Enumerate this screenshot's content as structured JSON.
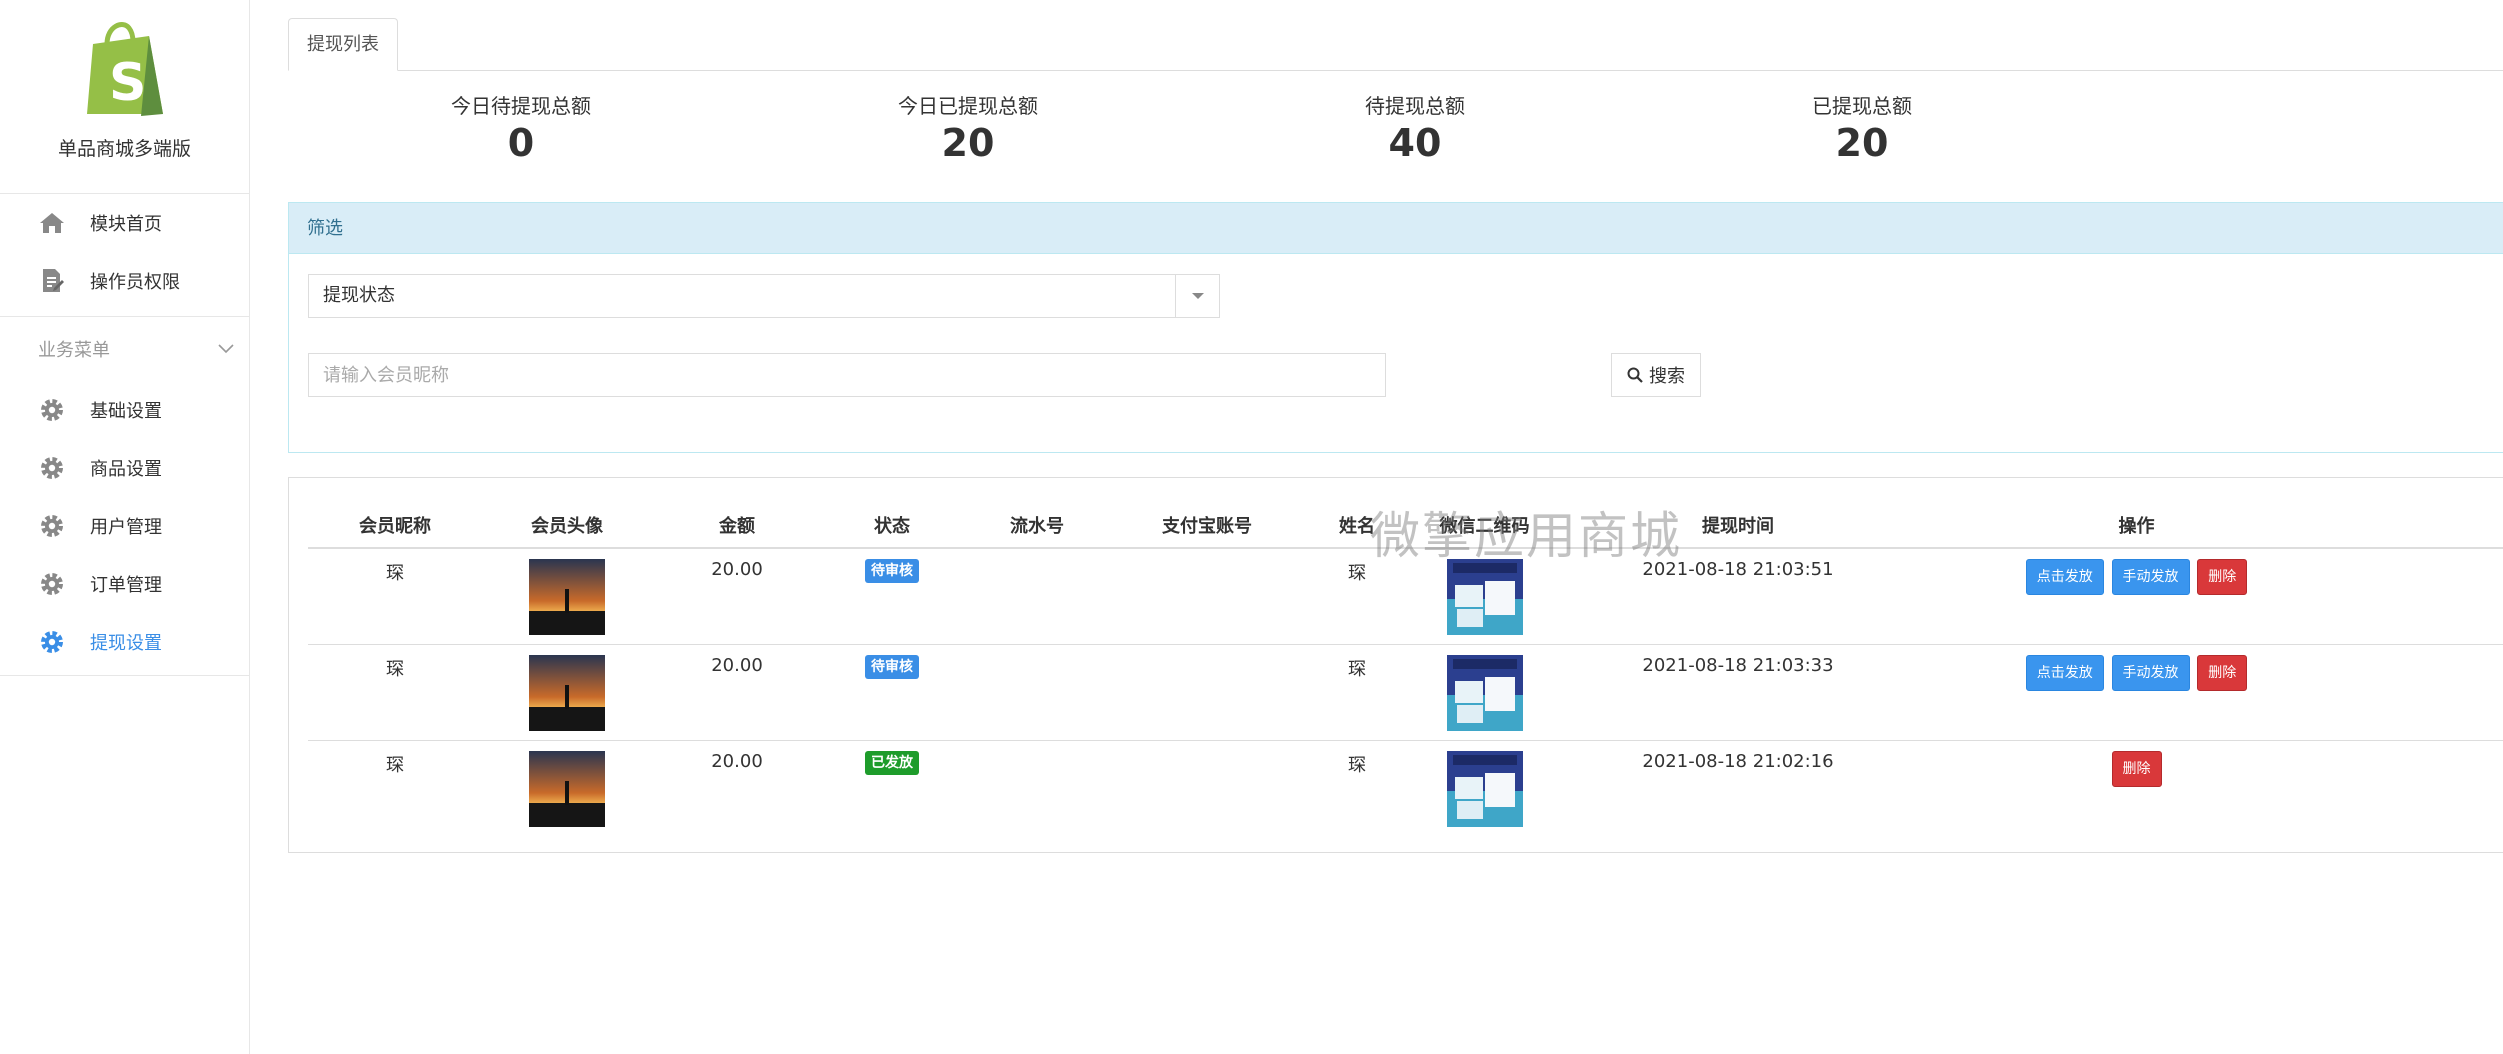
{
  "sidebar": {
    "logo_text": "单品商城多端版",
    "top_items": [
      {
        "label": "模块首页",
        "icon": "home-icon"
      },
      {
        "label": "操作员权限",
        "icon": "edit-document-icon"
      }
    ],
    "group_title": "业务菜单",
    "group_items": [
      {
        "label": "基础设置",
        "icon": "gear-icon"
      },
      {
        "label": "商品设置",
        "icon": "gear-icon"
      },
      {
        "label": "用户管理",
        "icon": "gear-icon"
      },
      {
        "label": "订单管理",
        "icon": "gear-icon"
      },
      {
        "label": "提现设置",
        "icon": "gear-icon",
        "active": true
      }
    ]
  },
  "tabs": [
    {
      "label": "提现列表"
    }
  ],
  "stats": [
    {
      "label": "今日待提现总额",
      "value": "0"
    },
    {
      "label": "今日已提现总额",
      "value": "20"
    },
    {
      "label": "待提现总额",
      "value": "40"
    },
    {
      "label": "已提现总额",
      "value": "20"
    }
  ],
  "filter": {
    "title": "筛选",
    "status_select_value": "提现状态",
    "search_placeholder": "请输入会员昵称",
    "search_button": "搜索"
  },
  "table": {
    "headers": [
      "会员昵称",
      "会员头像",
      "金额",
      "状态",
      "流水号",
      "支付宝账号",
      "姓名",
      "微信二维码",
      "提现时间",
      "操作"
    ],
    "rows": [
      {
        "nickname": "琛",
        "amount": "20.00",
        "status": "待审核",
        "serial": "",
        "alipay": "",
        "name": "琛",
        "time": "2021-08-18 21:03:51",
        "actions": [
          "点击发放",
          "手动发放",
          "删除"
        ]
      },
      {
        "nickname": "琛",
        "amount": "20.00",
        "status": "待审核",
        "serial": "",
        "alipay": "",
        "name": "琛",
        "time": "2021-08-18 21:03:33",
        "actions": [
          "点击发放",
          "手动发放",
          "删除"
        ]
      },
      {
        "nickname": "琛",
        "amount": "20.00",
        "status": "已发放",
        "serial": "",
        "alipay": "",
        "name": "琛",
        "time": "2021-08-18 21:02:16",
        "actions": [
          "删除"
        ]
      }
    ]
  },
  "watermark": "微擎应用商城",
  "colors": {
    "primary": "#3a95ee",
    "danger": "#d9383a",
    "success": "#1e9c2b",
    "active_nav": "#3a8ee6",
    "logo_green": "#95bf47"
  }
}
